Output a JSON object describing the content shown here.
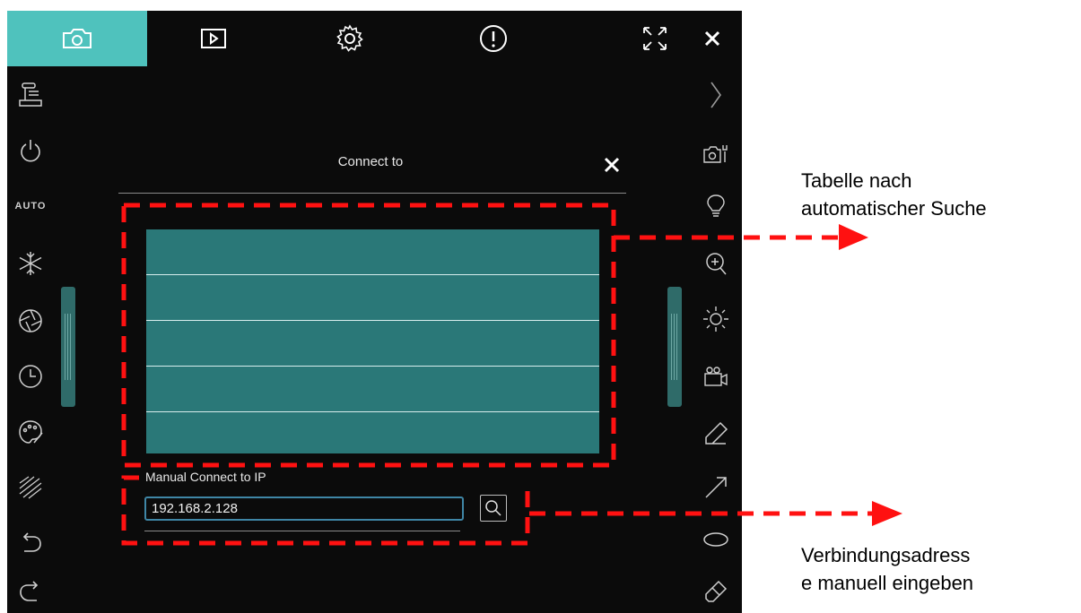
{
  "toolbar": {
    "tabs": [
      {
        "name": "camera-icon",
        "active": true
      },
      {
        "name": "play-icon",
        "active": false
      },
      {
        "name": "settings-gear-icon",
        "active": false
      },
      {
        "name": "info-alert-icon",
        "active": false
      }
    ],
    "right_icons": [
      "fullscreen-icon",
      "close-icon"
    ]
  },
  "left_sidebar": {
    "items": [
      "document-camera-icon",
      "power-icon",
      "auto-label",
      "snowflake-icon",
      "aperture-icon",
      "clock-icon",
      "palette-icon",
      "texture-icon",
      "undo-icon",
      "redo-icon"
    ],
    "auto_label": "AUTO"
  },
  "right_sidebar": {
    "items": [
      "chevron-right-icon",
      "camera-settings-icon",
      "lightbulb-icon",
      "zoom-in-icon",
      "brightness-icon",
      "video-camera-icon",
      "pen-icon",
      "arrow-icon",
      "ellipse-icon",
      "eraser-icon"
    ]
  },
  "dialog": {
    "title": "Connect to",
    "device_rows": [
      "",
      "",
      "",
      "",
      ""
    ],
    "manual_label": "Manual Connect to IP",
    "ip_value": "192.168.2.128"
  },
  "annotations": {
    "table_note_line1": "Tabelle nach",
    "table_note_line2": "automatischer Suche",
    "manual_note_line1": "Verbindungsadress",
    "manual_note_line2": "e manuell eingeben"
  },
  "colors": {
    "accent": "#4fc2bd",
    "table_bg": "#2a7878",
    "dash_red": "#ff1111",
    "app_bg": "#0b0b0b"
  }
}
